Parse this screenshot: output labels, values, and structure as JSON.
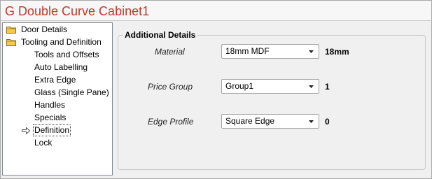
{
  "window": {
    "title": "G Double Curve Cabinet1"
  },
  "tree": {
    "items": [
      {
        "label": "Door Details",
        "type": "folder"
      },
      {
        "label": "Tooling and Definition",
        "type": "folder"
      },
      {
        "label": "Tools and Offsets",
        "type": "leaf"
      },
      {
        "label": "Auto Labelling",
        "type": "leaf"
      },
      {
        "label": "Extra Edge",
        "type": "leaf"
      },
      {
        "label": "Glass (Single Pane)",
        "type": "leaf"
      },
      {
        "label": "Handles",
        "type": "leaf"
      },
      {
        "label": "Specials",
        "type": "leaf"
      },
      {
        "label": "Definition",
        "type": "leaf",
        "selected": true,
        "icon": "arrow-right-icon"
      },
      {
        "label": "Lock",
        "type": "leaf"
      }
    ]
  },
  "details": {
    "legend": "Additional Details",
    "rows": [
      {
        "label": "Material",
        "selected": "18mm MDF",
        "value": "18mm"
      },
      {
        "label": "Price Group",
        "selected": "Group1",
        "value": "1"
      },
      {
        "label": "Edge Profile",
        "selected": "Square Edge",
        "value": "0"
      }
    ]
  },
  "colors": {
    "title": "#c0392b",
    "folder": "#f2c94c",
    "background": "#f0f0f0"
  }
}
